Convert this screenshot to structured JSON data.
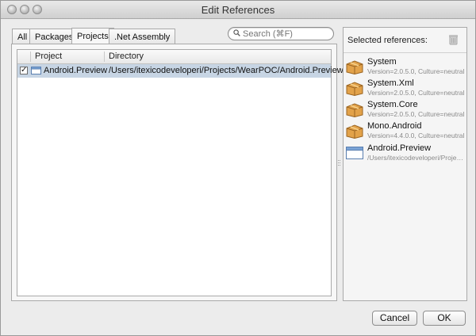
{
  "window": {
    "title": "Edit References"
  },
  "tabs": [
    {
      "label": "All"
    },
    {
      "label": "Packages"
    },
    {
      "label": "Projects",
      "active": true
    },
    {
      "label": ".Net Assembly"
    }
  ],
  "search": {
    "placeholder": "Search (⌘F)"
  },
  "table": {
    "columns": [
      "Project",
      "Directory"
    ],
    "rows": [
      {
        "checked": true,
        "project": "Android.Preview",
        "directory": "/Users/itexicodeveloperi/Projects/WearPOC/Android.Preview"
      }
    ]
  },
  "selected_panel": {
    "title": "Selected references:",
    "items": [
      {
        "name": "System",
        "detail": "Version=2.0.5.0, Culture=neutral",
        "icon": "package-box-icon"
      },
      {
        "name": "System.Xml",
        "detail": "Version=2.0.5.0, Culture=neutral",
        "icon": "package-box-icon"
      },
      {
        "name": "System.Core",
        "detail": "Version=2.0.5.0, Culture=neutral",
        "icon": "package-box-icon"
      },
      {
        "name": "Mono.Android",
        "detail": "Version=4.4.0.0, Culture=neutral",
        "icon": "package-box-icon"
      },
      {
        "name": "Android.Preview",
        "detail": "/Users/itexicodeveloperi/Projects/WearPOC",
        "icon": "project-window-icon"
      }
    ]
  },
  "buttons": {
    "cancel": "Cancel",
    "ok": "OK"
  },
  "colors": {
    "selection": "#c7d5e4",
    "box": "#e2a24a"
  }
}
